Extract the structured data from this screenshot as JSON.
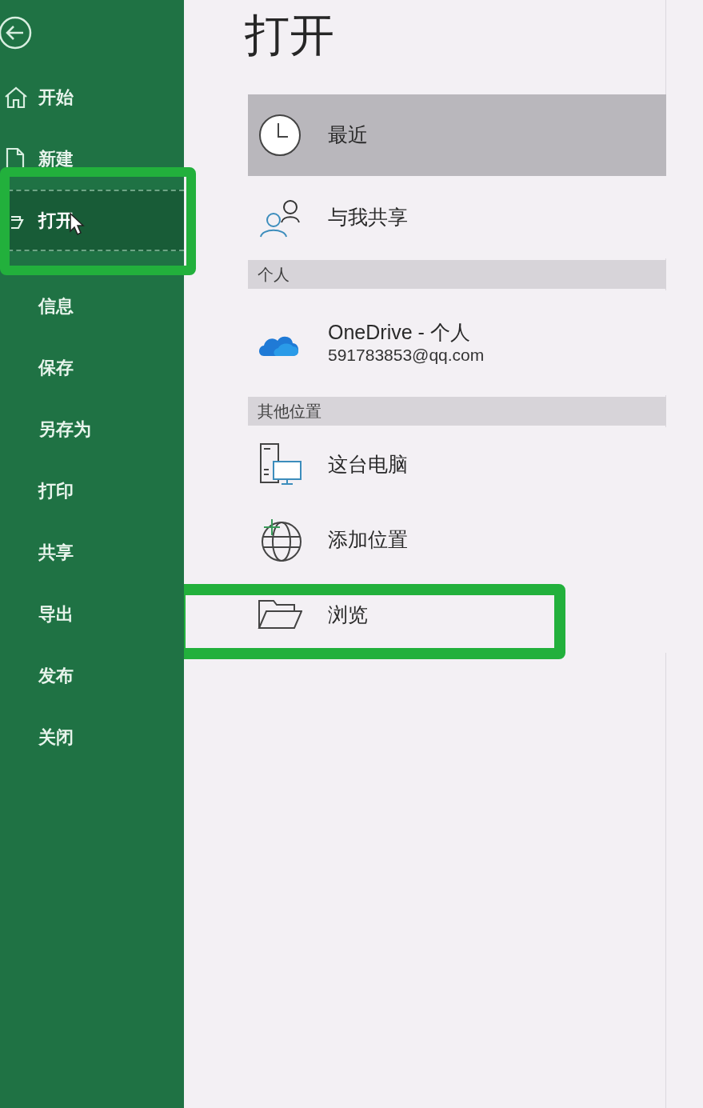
{
  "sidebar": {
    "items": [
      {
        "kind": "home",
        "label": "开始",
        "selected": false,
        "highlighted": false
      },
      {
        "kind": "new",
        "label": "新建",
        "selected": false,
        "highlighted": false
      },
      {
        "kind": "open",
        "label": "打开",
        "selected": true,
        "highlighted": true
      },
      {
        "kind": "text",
        "label": "信息",
        "selected": false,
        "highlighted": false
      },
      {
        "kind": "text",
        "label": "保存",
        "selected": false,
        "highlighted": false
      },
      {
        "kind": "text",
        "label": "另存为",
        "selected": false,
        "highlighted": false
      },
      {
        "kind": "text",
        "label": "打印",
        "selected": false,
        "highlighted": false
      },
      {
        "kind": "text",
        "label": "共享",
        "selected": false,
        "highlighted": false
      },
      {
        "kind": "text",
        "label": "导出",
        "selected": false,
        "highlighted": false
      },
      {
        "kind": "text",
        "label": "发布",
        "selected": false,
        "highlighted": false
      },
      {
        "kind": "text",
        "label": "关闭",
        "selected": false,
        "highlighted": false
      }
    ]
  },
  "title": "打开",
  "locations": [
    {
      "kind": "recent",
      "label": "最近",
      "selected": true,
      "highlighted": false
    },
    {
      "kind": "shared",
      "label": "与我共享",
      "selected": false,
      "highlighted": false
    },
    {
      "kind": "header",
      "label": "个人"
    },
    {
      "kind": "onedrive",
      "label": "OneDrive - 个人",
      "detail": "591783853@qq.com",
      "selected": false,
      "highlighted": false
    },
    {
      "kind": "header",
      "label": "其他位置"
    },
    {
      "kind": "pc",
      "label": "这台电脑",
      "selected": false,
      "highlighted": false
    },
    {
      "kind": "add",
      "label": "添加位置",
      "selected": false,
      "highlighted": false
    },
    {
      "kind": "browse",
      "label": "浏览",
      "selected": false,
      "highlighted": true
    }
  ]
}
